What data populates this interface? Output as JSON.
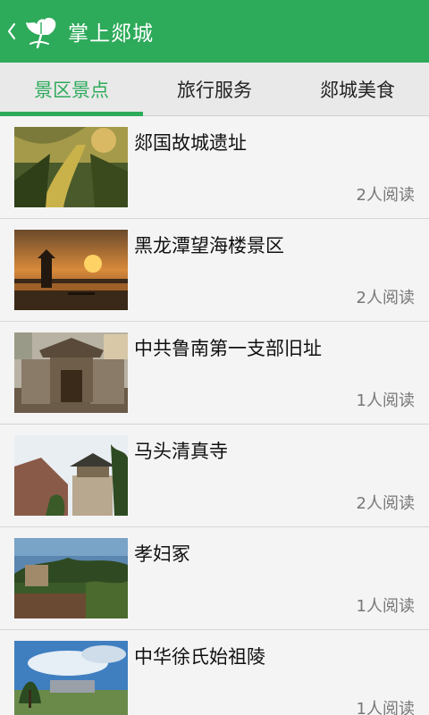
{
  "header": {
    "title": "掌上郯城",
    "back_icon": "chevron-left-icon",
    "logo_icon": "ginkgo-leaf-logo",
    "color": "#2daa5a"
  },
  "tabs": [
    {
      "label": "景区景点",
      "active": true
    },
    {
      "label": "旅行服务",
      "active": false
    },
    {
      "label": "郯城美食",
      "active": false
    }
  ],
  "items": [
    {
      "title": "郯国故城遗址",
      "reads": "2人阅读"
    },
    {
      "title": "黑龙潭望海楼景区",
      "reads": "2人阅读"
    },
    {
      "title": "中共鲁南第一支部旧址",
      "reads": "1人阅读"
    },
    {
      "title": "马头清真寺",
      "reads": "2人阅读"
    },
    {
      "title": "孝妇冢",
      "reads": "1人阅读"
    },
    {
      "title": "中华徐氏始祖陵",
      "reads": "1人阅读"
    }
  ]
}
